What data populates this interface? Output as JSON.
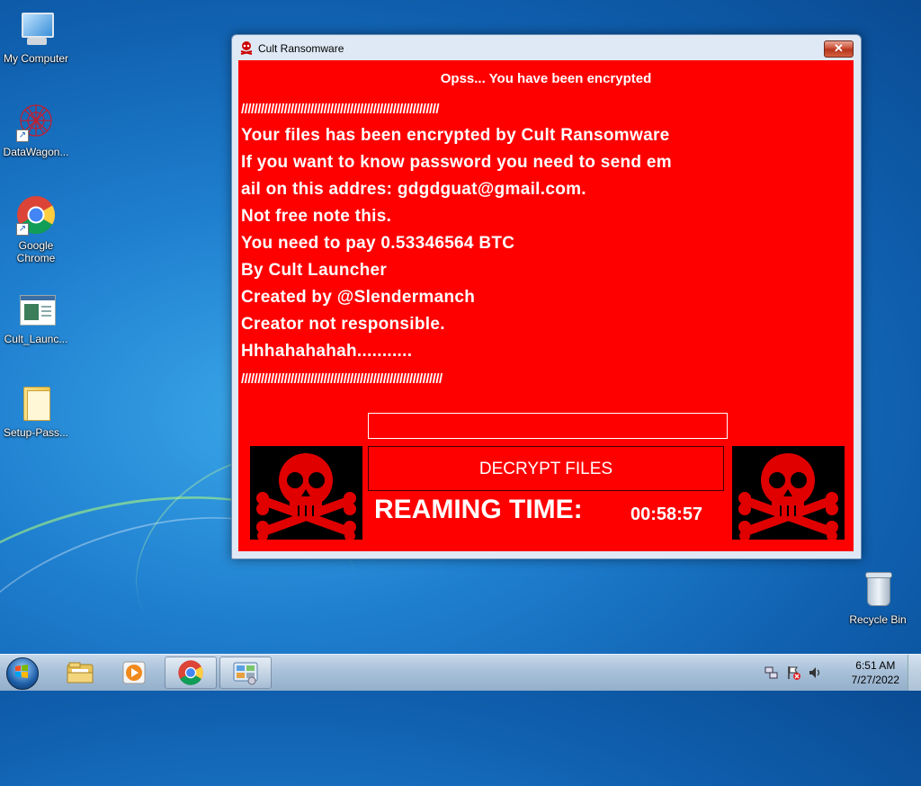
{
  "desktop": {
    "icons": [
      {
        "label": "My Computer",
        "icon": "computer-icon"
      },
      {
        "label": "DataWagon...",
        "icon": "datawagon-icon"
      },
      {
        "label": "Google Chrome",
        "icon": "chrome-icon"
      },
      {
        "label": "Cult_Launc...",
        "icon": "application-icon"
      },
      {
        "label": "Setup-Pass...",
        "icon": "folder-zip-icon"
      },
      {
        "label": "Recycle Bin",
        "icon": "recycle-bin-icon"
      }
    ]
  },
  "window": {
    "title": "Cult Ransomware",
    "close_label": "✕",
    "heading": "Opss... You have been encrypted",
    "lines": [
      "////////////////////////////////////////////////////////////",
      "Your files has been encrypted by Cult Ransomware",
      "If you want to know password you need to send em",
      "ail on this addres: gdgdguat@gmail.com.",
      "Not free note this.",
      "You need to pay 0.53346564 BTC",
      "By Cult Launcher",
      "Created by @Slendermanch",
      "Creator not responsible.",
      "Hhhahahahah...........",
      "/////////////////////////////////////////////////////////////"
    ],
    "password_value": "",
    "decrypt_label": "DECRYPT FILES",
    "timer_label": "REAMING TIME:",
    "timer_value": "00:58:57"
  },
  "taskbar": {
    "apps": [
      "file-explorer-icon",
      "media-player-icon",
      "chrome-icon",
      "control-panel-icon"
    ],
    "tray_icons": [
      "network-icon",
      "action-center-flag-icon",
      "volume-icon"
    ],
    "time": "6:51 AM",
    "date": "7/27/2022"
  },
  "colors": {
    "ransom_red": "#ff0000",
    "wallpaper_blue": "#1f7fcf"
  }
}
